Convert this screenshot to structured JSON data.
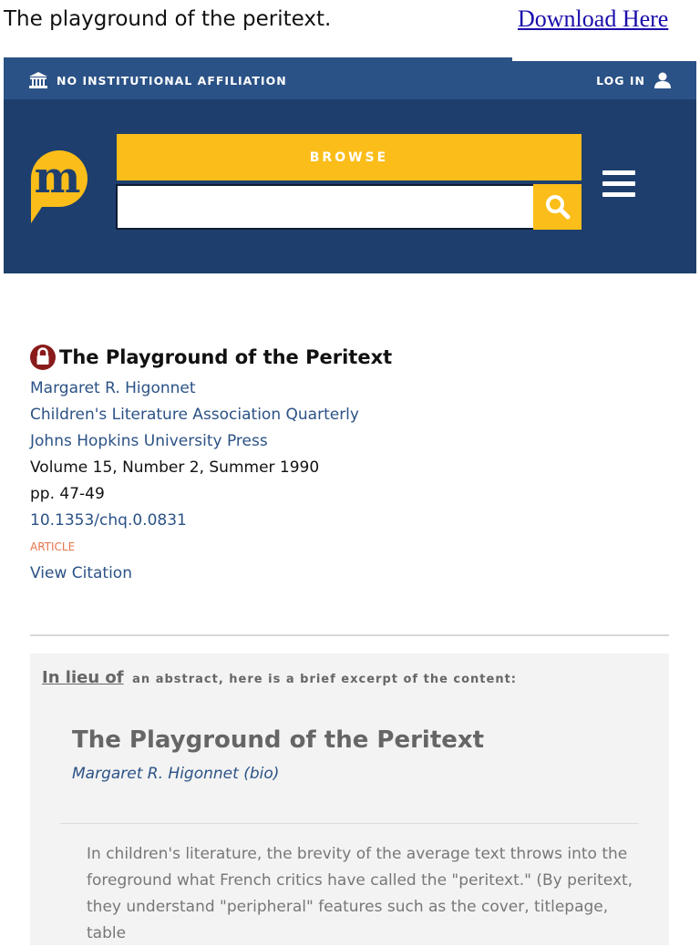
{
  "page": {
    "top_title": "The playground of the peritext.",
    "download_link": "Download Here"
  },
  "header": {
    "affiliation": "NO INSTITUTIONAL AFFILIATION",
    "login": "LOG IN",
    "logo_letter": "m",
    "browse_label": "BROWSE",
    "search_value": "",
    "colors": {
      "dark_blue": "#1e3f6e",
      "bar_blue": "#2b5286",
      "gold": "#fbbd19"
    }
  },
  "article": {
    "title": "The Playground of the Peritext",
    "author": "Margaret R. Higonnet",
    "journal": "Children's Literature Association Quarterly",
    "publisher": "Johns Hopkins University Press",
    "volume": "Volume 15, Number 2, Summer 1990",
    "pages": "pp. 47-49",
    "doi": "10.1353/chq.0.0831",
    "type": "ARTICLE",
    "view_citation": "View Citation"
  },
  "excerpt": {
    "lieu": "In lieu of",
    "intro": "an abstract, here is a brief excerpt of the content:",
    "title": "The Playground of the Peritext",
    "author": "Margaret R. Higonnet (bio)",
    "body": "In children's literature, the brevity of the average text throws into the foreground what French critics have called the \"peritext.\" (By peritext, they understand \"peripheral\" features such as the cover, titlepage, table"
  }
}
